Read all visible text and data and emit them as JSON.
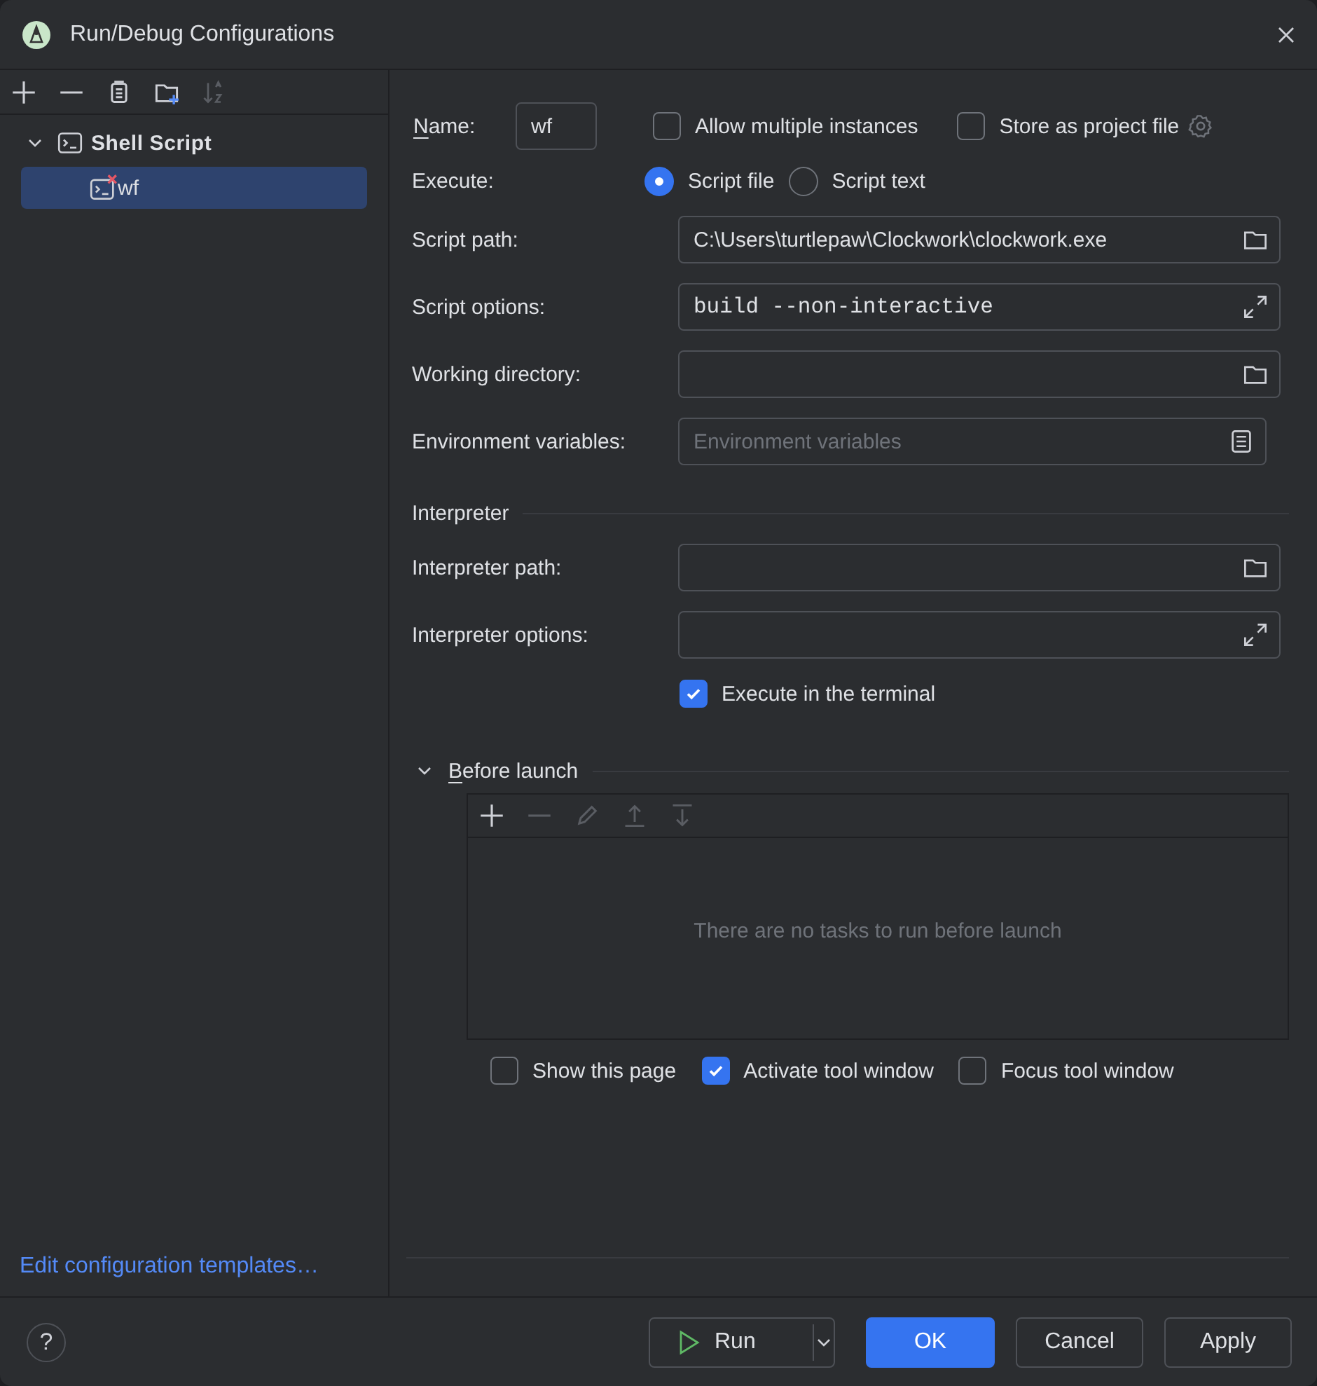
{
  "window": {
    "title": "Run/Debug Configurations"
  },
  "sidebar": {
    "toolbar": [
      {
        "kind": "add",
        "disabled": false
      },
      {
        "kind": "remove",
        "disabled": false
      },
      {
        "kind": "copy",
        "disabled": false
      },
      {
        "kind": "folder",
        "disabled": false
      },
      {
        "kind": "sort",
        "disabled": true
      }
    ],
    "tree": [
      {
        "label": "Shell Script",
        "expanded": true,
        "selected": false,
        "children": [
          {
            "label": "wf",
            "selected": true,
            "error": true
          }
        ]
      }
    ],
    "link": "Edit configuration templates…"
  },
  "form": {
    "name": {
      "label": "Name:",
      "mnemonic_underlined": true,
      "value": "wf"
    },
    "allow_multiple": {
      "label": "Allow multiple instances",
      "checked": false
    },
    "store_as_project": {
      "label": "Store as project file",
      "checked": false
    },
    "execute": {
      "label": "Execute:",
      "options": [
        {
          "label": "Script file",
          "selected": true
        },
        {
          "label": "Script text",
          "selected": false
        }
      ]
    },
    "fields": [
      {
        "label": "Script path:",
        "value": "C:\\Users\\turtlepaw\\Clockwork\\clockwork.exe",
        "kind": "browse"
      },
      {
        "label": "Script options:",
        "value": "build --non-interactive",
        "kind": "expand",
        "mono": true
      },
      {
        "label": "Working directory:",
        "kind": "browse"
      },
      {
        "label": "Environment variables:",
        "placeholder": "Environment variables",
        "kind": "list"
      }
    ],
    "interpreter": {
      "title": "Interpreter",
      "fields": [
        {
          "label": "Interpreter path:",
          "kind": "browse"
        },
        {
          "label": "Interpreter options:",
          "kind": "expand"
        }
      ]
    },
    "execute_in_terminal": {
      "label": "Execute in the terminal",
      "checked": true
    },
    "before_launch": {
      "title": "Before launch",
      "mnemonic_underlined": true,
      "expanded": true,
      "toolbar": [
        {
          "kind": "add",
          "disabled": false
        },
        {
          "kind": "remove",
          "disabled": true
        },
        {
          "kind": "edit",
          "disabled": true
        },
        {
          "kind": "up",
          "disabled": true
        },
        {
          "kind": "down",
          "disabled": true
        }
      ],
      "empty_text": "There are no tasks to run before launch",
      "options": [
        {
          "label": "Show this page",
          "checked": false
        },
        {
          "label": "Activate tool window",
          "checked": true
        },
        {
          "label": "Focus tool window",
          "checked": false
        }
      ]
    }
  },
  "footer": {
    "help": "?",
    "buttons": [
      {
        "label": "Run",
        "kind": "split"
      },
      {
        "label": "OK",
        "kind": "primary"
      },
      {
        "label": "Cancel",
        "kind": "plain"
      },
      {
        "label": "Apply",
        "kind": "plain"
      }
    ]
  }
}
